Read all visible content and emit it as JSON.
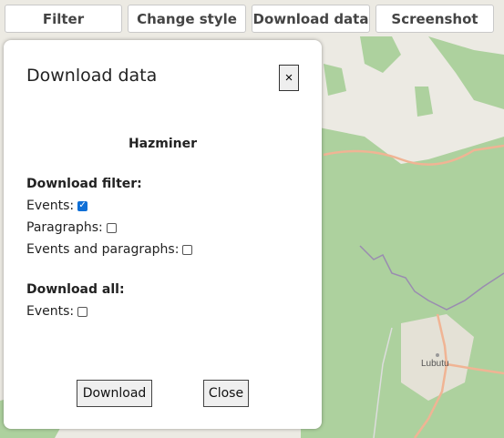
{
  "toolbar": {
    "filter": "Filter",
    "change_style": "Change style",
    "download_data": "Download data",
    "screenshot": "Screenshot"
  },
  "map": {
    "town_label": "Lubutu",
    "colors": {
      "land": "#eceae3",
      "forest": "#add19e",
      "road": "#f0b494",
      "border": "#9a8cb0",
      "river": "#aad3df"
    }
  },
  "dialog": {
    "title": "Download data",
    "close_x": "×",
    "source": "Hazminer",
    "filter_heading": "Download filter:",
    "filter_options": [
      {
        "label": "Events:",
        "checked": true
      },
      {
        "label": "Paragraphs:",
        "checked": false
      },
      {
        "label": "Events and paragraphs:",
        "checked": false
      }
    ],
    "all_heading": "Download all:",
    "all_options": [
      {
        "label": "Events:",
        "checked": false
      }
    ],
    "download_button": "Download",
    "close_button": "Close"
  }
}
